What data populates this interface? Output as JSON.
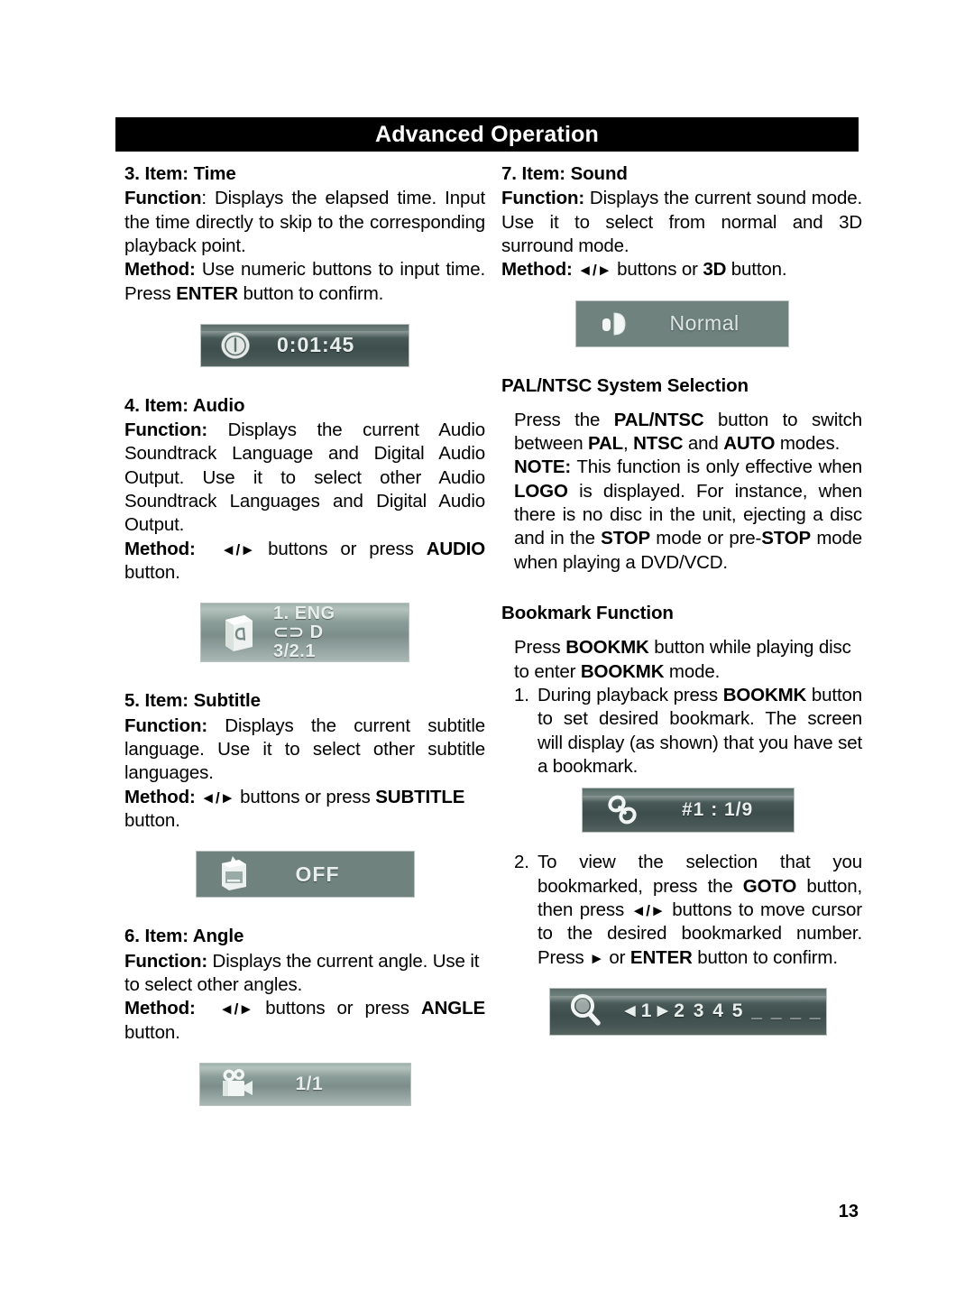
{
  "header": {
    "title": "Advanced Operation"
  },
  "page_number": "13",
  "left_column": {
    "item3": {
      "heading": "3. Item: Time",
      "function_label": "Function",
      "function_sep": ": ",
      "function_text": "Displays the elapsed time. Input the time directly to skip to the corresponding playback point.",
      "method_label": "Method:",
      "method_text_1": " Use numeric buttons to input time. Press ",
      "method_bold_1": "ENTER",
      "method_text_2": " button to confirm.",
      "osd": {
        "name": "time-osd",
        "icon": "clock-icon",
        "value": "0:01:45"
      }
    },
    "item4": {
      "heading": "4. Item: Audio",
      "function_label": "Function:",
      "function_text": " Displays the current Audio Soundtrack Language and Digital Audio Output. Use it to select other Audio Soundtrack Languages and Digital Audio Output.",
      "method_label": "Method:",
      "method_arrows": "◄/►",
      "method_text_1": " buttons or press ",
      "method_bold_1": "AUDIO",
      "method_text_2": " button.",
      "osd": {
        "name": "audio-osd",
        "icon": "audio-note-icon",
        "line1": "1. ENG",
        "line2": "⊂⊃ D",
        "line3": "3/2.1"
      }
    },
    "item5": {
      "heading": "5. Item: Subtitle",
      "function_label": "Function:",
      "function_text": " Displays the current subtitle language. Use it to select other subtitle languages.",
      "method_label": "Method:",
      "method_arrows": "◄/►",
      "method_text_1": " buttons or press ",
      "method_bold_1": "SUBTITLE",
      "method_text_2": " button.",
      "osd": {
        "name": "subtitle-osd",
        "icon": "subtitle-screen-icon",
        "value": "OFF"
      }
    },
    "item6": {
      "heading": "6. Item: Angle",
      "function_label": "Function:",
      "function_text": " Displays the current angle. Use it to select other angles.",
      "method_label": "Method:",
      "method_arrows": "◄/►",
      "method_text_1": " buttons or press ",
      "method_bold_1": "ANGLE",
      "method_text_2": " button.",
      "osd": {
        "name": "angle-osd",
        "icon": "movie-camera-icon",
        "value": "1/1"
      }
    }
  },
  "right_column": {
    "item7": {
      "heading": "7. Item: Sound",
      "function_label": "Function:",
      "function_text": " Displays the current sound mode. Use it to select from normal and 3D surround mode.",
      "method_label": "Method:",
      "method_arrows": "◄/►",
      "method_text_1": " buttons or ",
      "method_bold_1": "3D",
      "method_text_2": " button.",
      "osd": {
        "name": "sound-osd",
        "icon": "speaker-icon",
        "value": "Normal"
      }
    },
    "palntsc": {
      "heading": "PAL/NTSC System Selection",
      "p1_a": "Press the ",
      "p1_b1": "PAL/NTSC",
      "p1_c": " button to switch between ",
      "p1_b2": "PAL",
      "p1_d": ", ",
      "p1_b3": "NTSC",
      "p1_e": " and ",
      "p1_b4": "AUTO",
      "p1_f": " modes.",
      "p2_b1": "NOTE:",
      "p2_a": " This function is only effective when ",
      "p2_b2": "LOGO",
      "p2_b": " is displayed. For instance, when there is no disc in the unit, ejecting a disc and in the ",
      "p2_b3": "STOP",
      "p2_c": " mode or pre-",
      "p2_b4": "STOP",
      "p2_d": " mode when playing a DVD/VCD."
    },
    "bookmark": {
      "heading": "Bookmark Function",
      "intro_a": "Press ",
      "intro_b1": "BOOKMK",
      "intro_b": " button while playing disc to enter ",
      "intro_b2": "BOOKMK",
      "intro_c": " mode.",
      "step1": {
        "num": "1.",
        "a": "During playback press ",
        "b1": "BOOKMK",
        "b": " button to set desired bookmark. The screen will display (as shown) that you have set a bookmark."
      },
      "osd": {
        "name": "bookmark-osd",
        "icon": "chain-link-icon",
        "value": "#1 : 1/9"
      },
      "step2": {
        "num": "2.",
        "a": "To view the selection that you bookmarked, press the ",
        "b1": "GOTO",
        "b": " button, then press ",
        "arrows": "◄/►",
        "c": " buttons to move cursor to the desired bookmarked number. Press ",
        "arrow_r": "►",
        "d": " or ",
        "b2": "ENTER",
        "e": " button to confirm."
      },
      "osd2": {
        "name": "goto-osd",
        "icon": "magnifier-icon",
        "value": "◄1►2 3 4 5 _ _ _ _"
      }
    }
  },
  "colors": {
    "banner_bg": "#000000",
    "banner_text": "#ffffff",
    "osd_dark": "#485856",
    "osd_light": "#6f827e",
    "osd_light_grad": "#9fb0ab",
    "osd_text": "#e8eeec",
    "page_bg": "#ffffff",
    "body_text": "#000000"
  }
}
